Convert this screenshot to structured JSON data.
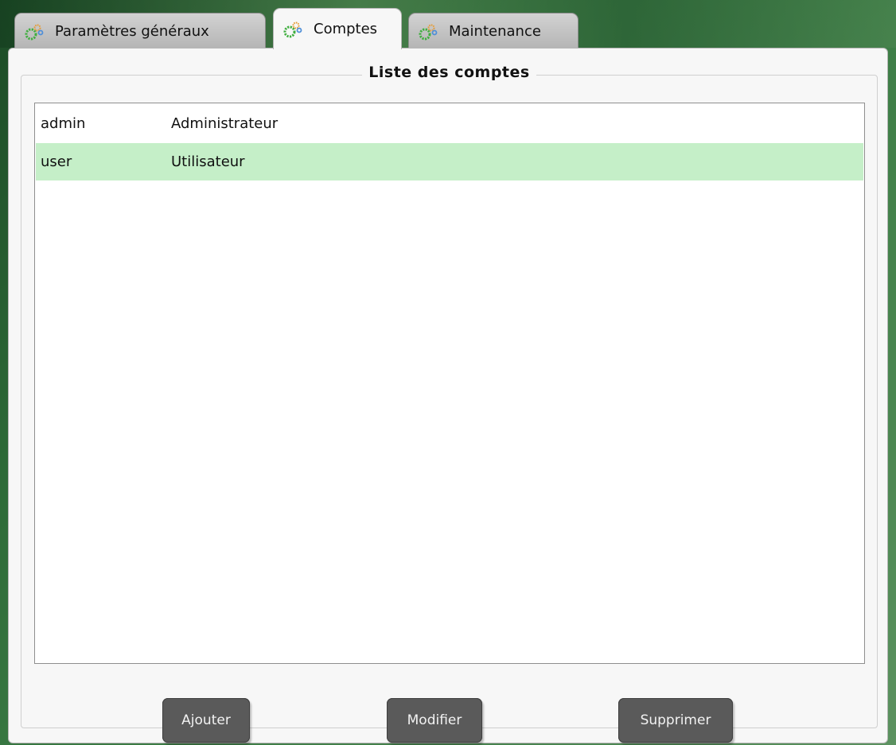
{
  "tabs": [
    {
      "label": "Paramètres généraux",
      "active": false,
      "icon": "gear-icon"
    },
    {
      "label": "Comptes",
      "active": true,
      "icon": "gear-icon"
    },
    {
      "label": "Maintenance",
      "active": false,
      "icon": "gear-icon"
    }
  ],
  "group": {
    "title": "Liste des comptes"
  },
  "accounts": [
    {
      "login": "admin",
      "role": "Administrateur",
      "selected": false
    },
    {
      "login": "user",
      "role": "Utilisateur",
      "selected": true
    }
  ],
  "buttons": {
    "add": "Ajouter",
    "edit": "Modifier",
    "delete": "Supprimer"
  },
  "colors": {
    "selected_row": "#c5efc8",
    "button": "#5a5a5a",
    "gear_green": "#3fae3f",
    "gear_orange": "#e69a32",
    "gear_blue": "#4f8fd8"
  }
}
